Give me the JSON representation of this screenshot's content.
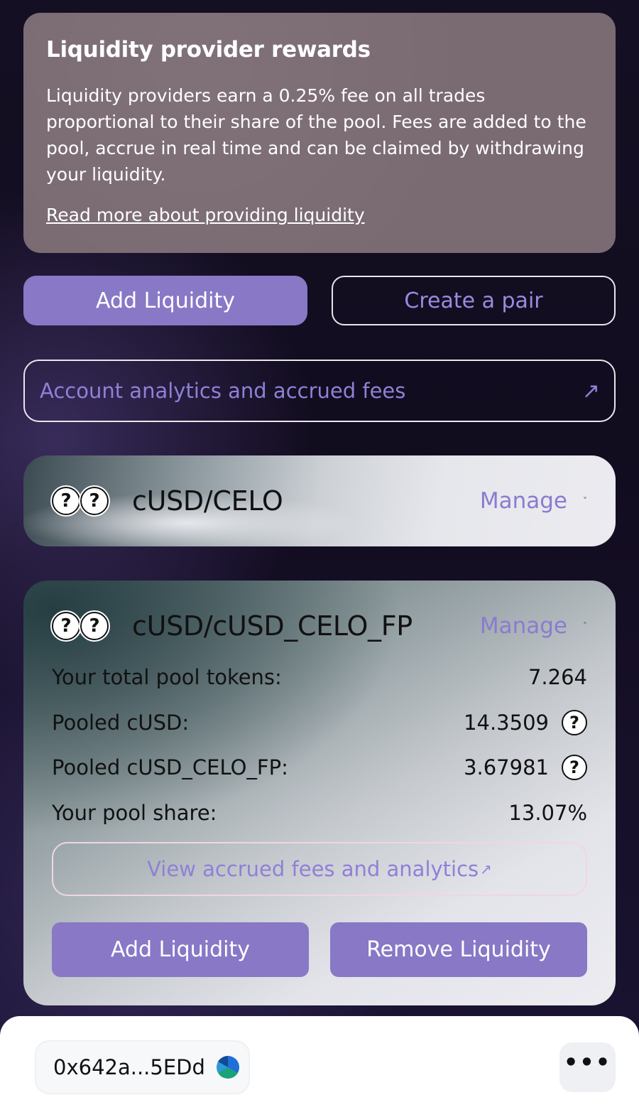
{
  "rewards": {
    "title": "Liquidity provider rewards",
    "body": "Liquidity providers earn a 0.25% fee on all trades proportional to their share of the pool. Fees are added to the pool, accrue in real time and can be claimed by withdrawing your liquidity.",
    "link": "Read more about providing liquidity"
  },
  "actions": {
    "add_liquidity": "Add Liquidity",
    "create_pair": "Create a pair"
  },
  "analytics_link": {
    "label": "Account analytics and accrued fees",
    "arrow": "↗"
  },
  "pools": [
    {
      "name": "cUSD/CELO",
      "manage": "Manage",
      "chevron": "˅",
      "icons": [
        "?",
        "?"
      ]
    },
    {
      "name": "cUSD/cUSD_CELO_FP",
      "manage": "Manage",
      "chevron": "˄",
      "icons": [
        "?",
        "?"
      ],
      "details": {
        "total_tokens_label": "Your total pool tokens:",
        "total_tokens_value": "7.264",
        "pooled_a_label": "Pooled cUSD:",
        "pooled_a_value": "14.3509",
        "pooled_b_label": "Pooled cUSD_CELO_FP:",
        "pooled_b_value": "3.67981",
        "share_label": "Your pool share:",
        "share_value": "13.07%"
      },
      "view_fees": "View accrued fees and analytics",
      "view_fees_arrow": "↗",
      "add_liquidity": "Add Liquidity",
      "remove_liquidity": "Remove Liquidity"
    }
  ],
  "bottom_bar": {
    "account": "0x642a...5EDd",
    "menu": "•••"
  },
  "colors": {
    "accent": "#8878c6",
    "accent_text": "#8f80d6",
    "background": "#140f22"
  }
}
